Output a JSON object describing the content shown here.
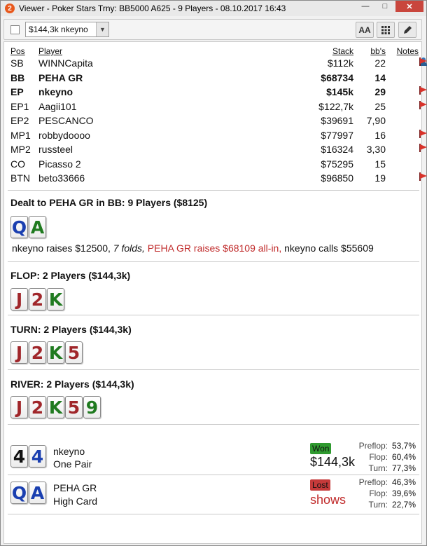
{
  "window": {
    "title": "Viewer - Poker Stars Trny: BB5000 A625 - 9 Players - 08.10.2017 16:43",
    "app_icon": "2",
    "minimize": "—",
    "maximize": "□",
    "close": "✕"
  },
  "toolbar": {
    "hand_select_value": "$144,3k nkeyno",
    "font_button": "AA",
    "grid_button": "grid-icon",
    "edit_button": "pencil-icon"
  },
  "players_header": {
    "pos": "Pos",
    "player": "Player",
    "stack": "Stack",
    "bbs": "bb's",
    "notes": "Notes"
  },
  "players": [
    {
      "pos": "SB",
      "name": "WINNCapita",
      "stack": "$112k",
      "bbs": "22",
      "bold": false,
      "notes": [
        "person",
        "flag"
      ]
    },
    {
      "pos": "BB",
      "name": "PEHA GR",
      "stack": "$68734",
      "bbs": "14",
      "bold": true,
      "notes": []
    },
    {
      "pos": "EP",
      "name": "nkeyno",
      "stack": "$145k",
      "bbs": "29",
      "bold": true,
      "notes": [
        "flag"
      ]
    },
    {
      "pos": "EP1",
      "name": "Aagii101",
      "stack": "$122,7k",
      "bbs": "25",
      "bold": false,
      "notes": [
        "flag"
      ]
    },
    {
      "pos": "EP2",
      "name": "PESCANCO",
      "stack": "$39691",
      "bbs": "7,90",
      "bold": false,
      "notes": []
    },
    {
      "pos": "MP1",
      "name": "robbydoooo",
      "stack": "$77997",
      "bbs": "16",
      "bold": false,
      "notes": [
        "flag"
      ]
    },
    {
      "pos": "MP2",
      "name": "russteel",
      "stack": "$16324",
      "bbs": "3,30",
      "bold": false,
      "notes": [
        "flag"
      ]
    },
    {
      "pos": "CO",
      "name": "Picasso 2",
      "stack": "$75295",
      "bbs": "15",
      "bold": false,
      "notes": []
    },
    {
      "pos": "BTN",
      "name": "beto33666",
      "stack": "$96850",
      "bbs": "19",
      "bold": false,
      "notes": [
        "flag"
      ]
    }
  ],
  "colors": {
    "red_card": "#a0262a",
    "green_card": "#1f7a1f",
    "blue_card": "#1a3fb0",
    "black_card": "#111111",
    "raise_red": "#c02a2a"
  },
  "preflop": {
    "heading": "Dealt to PEHA GR in BB: 9 Players ($8125)",
    "cards": [
      {
        "rank": "Q",
        "color": "#1a3fb0"
      },
      {
        "rank": "A",
        "color": "#1f7a1f"
      }
    ],
    "action_1": "nkeyno raises $12500,",
    "action_2": "7 folds,",
    "action_3": "PEHA GR raises $68109 all-in,",
    "action_4": "nkeyno calls $55609"
  },
  "flop": {
    "heading": "FLOP: 2 Players ($144,3k)",
    "cards": [
      {
        "rank": "J",
        "color": "#a0262a"
      },
      {
        "rank": "2",
        "color": "#a0262a"
      },
      {
        "rank": "K",
        "color": "#1f7a1f"
      }
    ]
  },
  "turn": {
    "heading": "TURN: 2 Players ($144,3k)",
    "cards": [
      {
        "rank": "J",
        "color": "#a0262a"
      },
      {
        "rank": "2",
        "color": "#a0262a"
      },
      {
        "rank": "K",
        "color": "#1f7a1f"
      },
      {
        "rank": "5",
        "color": "#a0262a"
      }
    ]
  },
  "river": {
    "heading": "RIVER: 2 Players ($144,3k)",
    "cards": [
      {
        "rank": "J",
        "color": "#a0262a"
      },
      {
        "rank": "2",
        "color": "#a0262a"
      },
      {
        "rank": "K",
        "color": "#1f7a1f"
      },
      {
        "rank": "5",
        "color": "#a0262a"
      },
      {
        "rank": "9",
        "color": "#1f7a1f"
      }
    ]
  },
  "results": [
    {
      "cards": [
        {
          "rank": "4",
          "color": "#111111"
        },
        {
          "rank": "4",
          "color": "#1a3fb0"
        }
      ],
      "name": "nkeyno",
      "hand": "One Pair",
      "badge": "Won",
      "value": "$144,3k",
      "stats": [
        {
          "k": "Preflop:",
          "v": "53,7%"
        },
        {
          "k": "Flop:",
          "v": "60,4%"
        },
        {
          "k": "Turn:",
          "v": "77,3%"
        }
      ]
    },
    {
      "cards": [
        {
          "rank": "Q",
          "color": "#1a3fb0"
        },
        {
          "rank": "A",
          "color": "#1a3fb0"
        }
      ],
      "name": "PEHA GR",
      "hand": "High Card",
      "badge": "Lost",
      "value": "shows",
      "stats": [
        {
          "k": "Preflop:",
          "v": "46,3%"
        },
        {
          "k": "Flop:",
          "v": "39,6%"
        },
        {
          "k": "Turn:",
          "v": "22,7%"
        }
      ]
    }
  ]
}
